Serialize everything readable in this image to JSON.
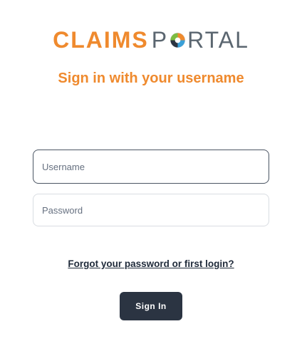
{
  "logo": {
    "brand_part1": "CLAIMS",
    "brand_part2_before": "P",
    "brand_part2_after": "RTAL",
    "icon": "portal-swirl-o-icon",
    "colors": {
      "claims": "#ef8a2e",
      "portal": "#5b6670",
      "swirl_orange": "#ef8a2e",
      "swirl_green": "#7cbd42",
      "swirl_blue": "#3aa0d8",
      "swirl_navy": "#2b3442"
    }
  },
  "heading": "Sign in with your username",
  "form": {
    "username": {
      "value": "",
      "placeholder": "Username"
    },
    "password": {
      "value": "",
      "placeholder": "Password"
    },
    "forgot_link": "Forgot your password or first login?",
    "submit_label": "Sign In"
  },
  "theme": {
    "accent": "#ef8a2e",
    "button_bg": "#2b3442",
    "link": "#1f2a3a"
  }
}
